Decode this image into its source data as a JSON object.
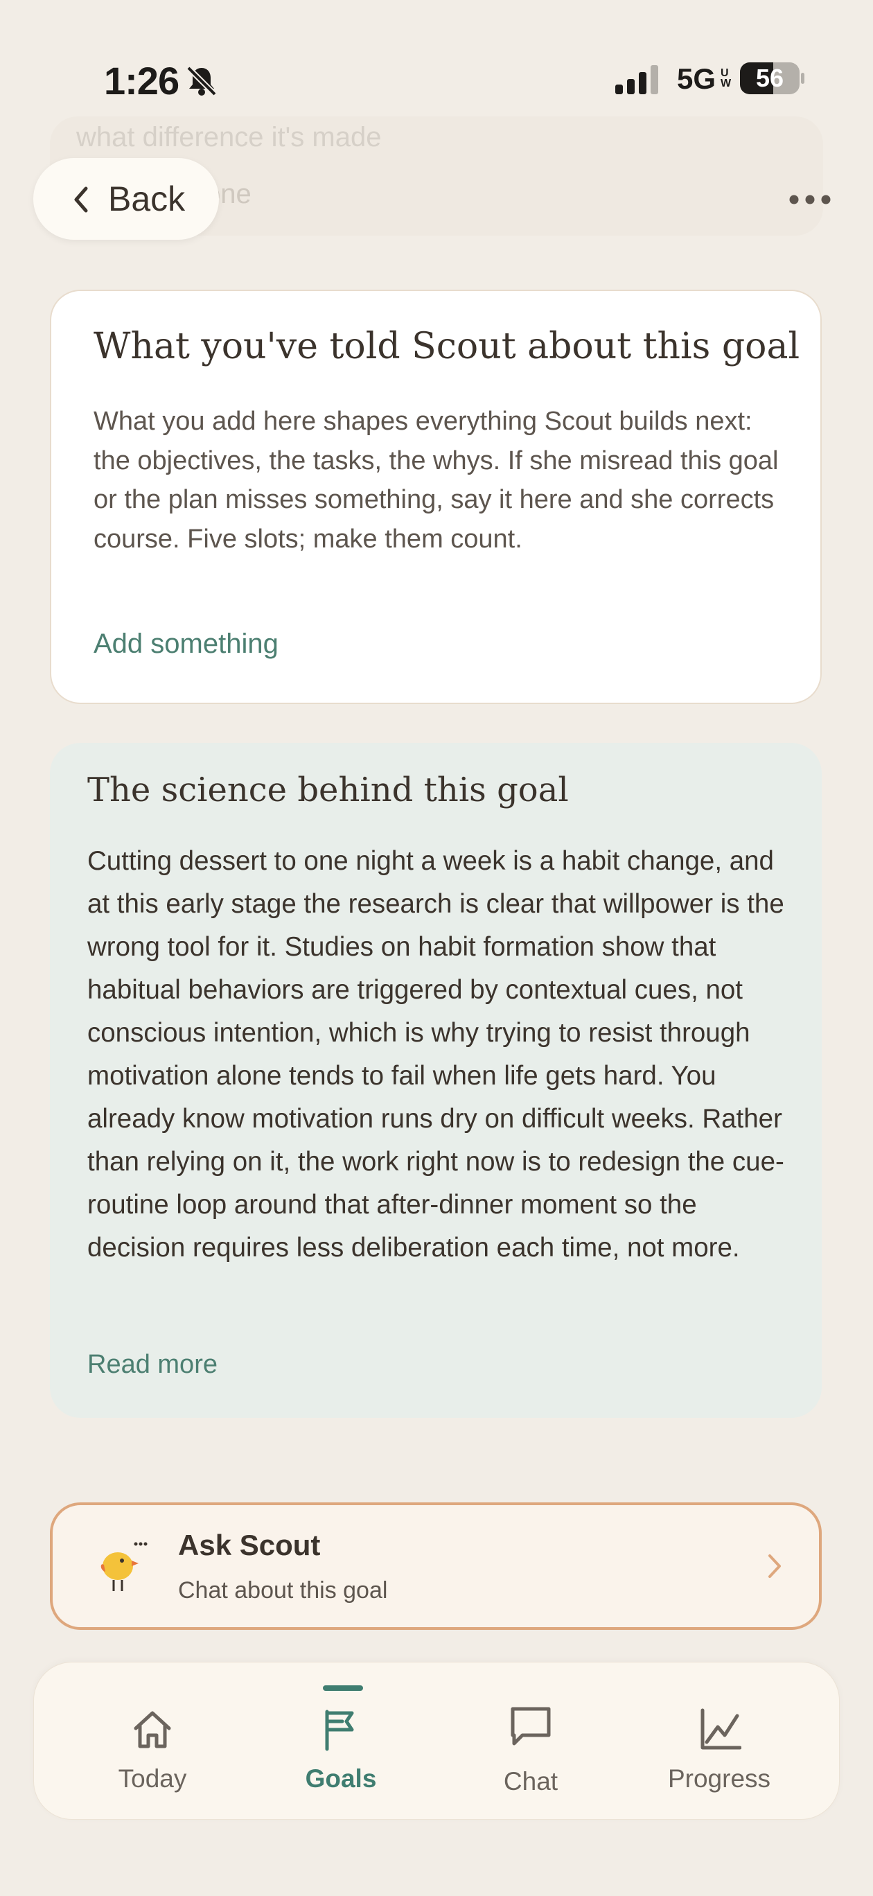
{
  "status_bar": {
    "time": "1:26",
    "network": "5G",
    "network_badge": "UW",
    "battery": "56",
    "battery_level": 0.56
  },
  "top_bar": {
    "back_label": "Back",
    "behind_text_top": "what difference it's made",
    "behind_text_partial": "one"
  },
  "scout_notes": {
    "title": "What you've told Scout about this goal",
    "body": "What you add here shapes everything Scout builds next: the objectives, the tasks, the whys. If she misread this goal or the plan misses something, say it here and she corrects course. Five slots; make them count.",
    "action": "Add something"
  },
  "science": {
    "title": "The science behind this goal",
    "body": "Cutting dessert to one night a week is a habit change, and at this early stage the research is clear that willpower is the wrong tool for it. Studies on habit formation show that habitual behaviors are triggered by contextual cues, not conscious intention, which is why trying to resist through motivation alone tends to fail when life gets hard. You already know motivation runs dry on difficult weeks. Rather than relying on it, the work right now is to redesign the cue-routine loop around that after-dinner moment so the decision requires less deliberation each time, not more.",
    "action": "Read more"
  },
  "ask_scout": {
    "title": "Ask Scout",
    "subtitle": "Chat about this goal"
  },
  "tabs": [
    {
      "label": "Today",
      "icon": "home-icon",
      "active": false
    },
    {
      "label": "Goals",
      "icon": "flag-icon",
      "active": true
    },
    {
      "label": "Chat",
      "icon": "chat-bubble-icon",
      "active": false
    },
    {
      "label": "Progress",
      "icon": "chart-line-icon",
      "active": false
    }
  ],
  "colors": {
    "background": "#f2ede6",
    "accent": "#3f7d70",
    "ask_border": "#dea77d",
    "science_card": "#e8eeea"
  }
}
